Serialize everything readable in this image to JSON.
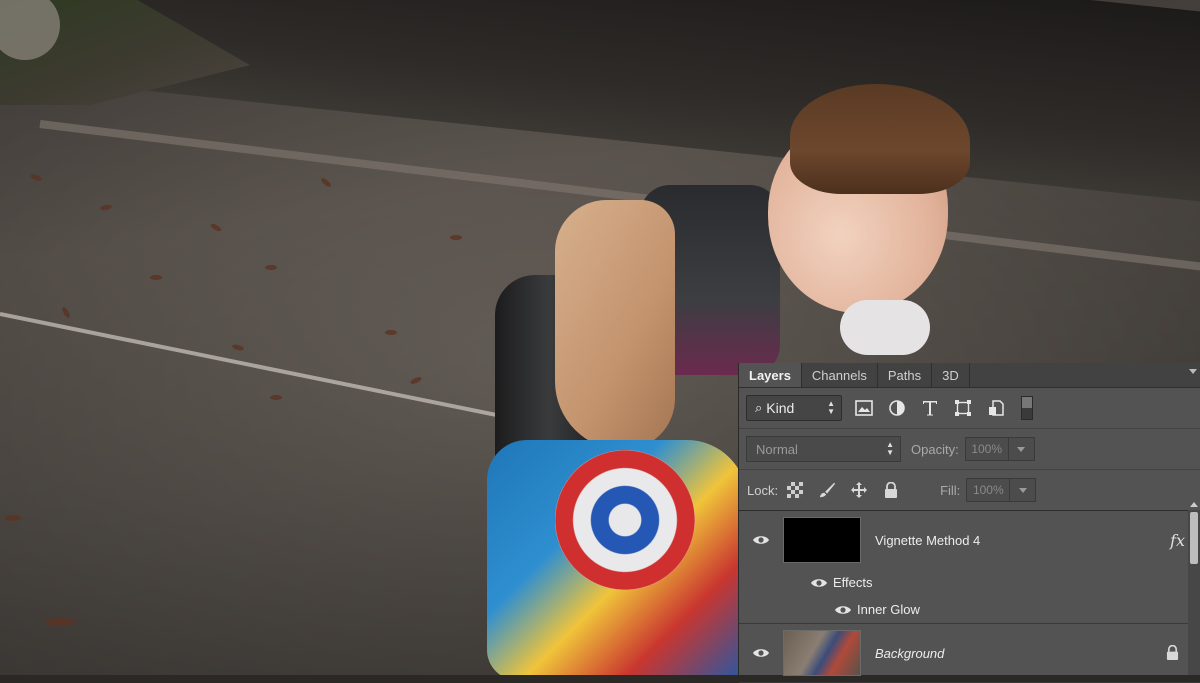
{
  "panel": {
    "tabs": [
      {
        "label": "Layers",
        "active": true
      },
      {
        "label": "Channels",
        "active": false
      },
      {
        "label": "Paths",
        "active": false
      },
      {
        "label": "3D",
        "active": false
      }
    ],
    "filter": {
      "kind_label": "Kind",
      "icons": [
        "pixel-filter-icon",
        "adjustment-filter-icon",
        "type-filter-icon",
        "shape-filter-icon",
        "smart-object-filter-icon"
      ]
    },
    "blend": {
      "mode": "Normal",
      "opacity_label": "Opacity:",
      "opacity_value": "100%"
    },
    "lock": {
      "label": "Lock:",
      "fill_label": "Fill:",
      "fill_value": "100%"
    },
    "layers": [
      {
        "name": "Vignette Method 4",
        "visible": true,
        "has_fx": true
      },
      {
        "name": "Background",
        "visible": true,
        "locked": true
      }
    ],
    "effects": {
      "label": "Effects",
      "items": [
        "Inner Glow"
      ]
    }
  },
  "colors": {
    "panel_bg": "#535353",
    "tabbar_bg": "#424242",
    "text": "#ececec"
  }
}
